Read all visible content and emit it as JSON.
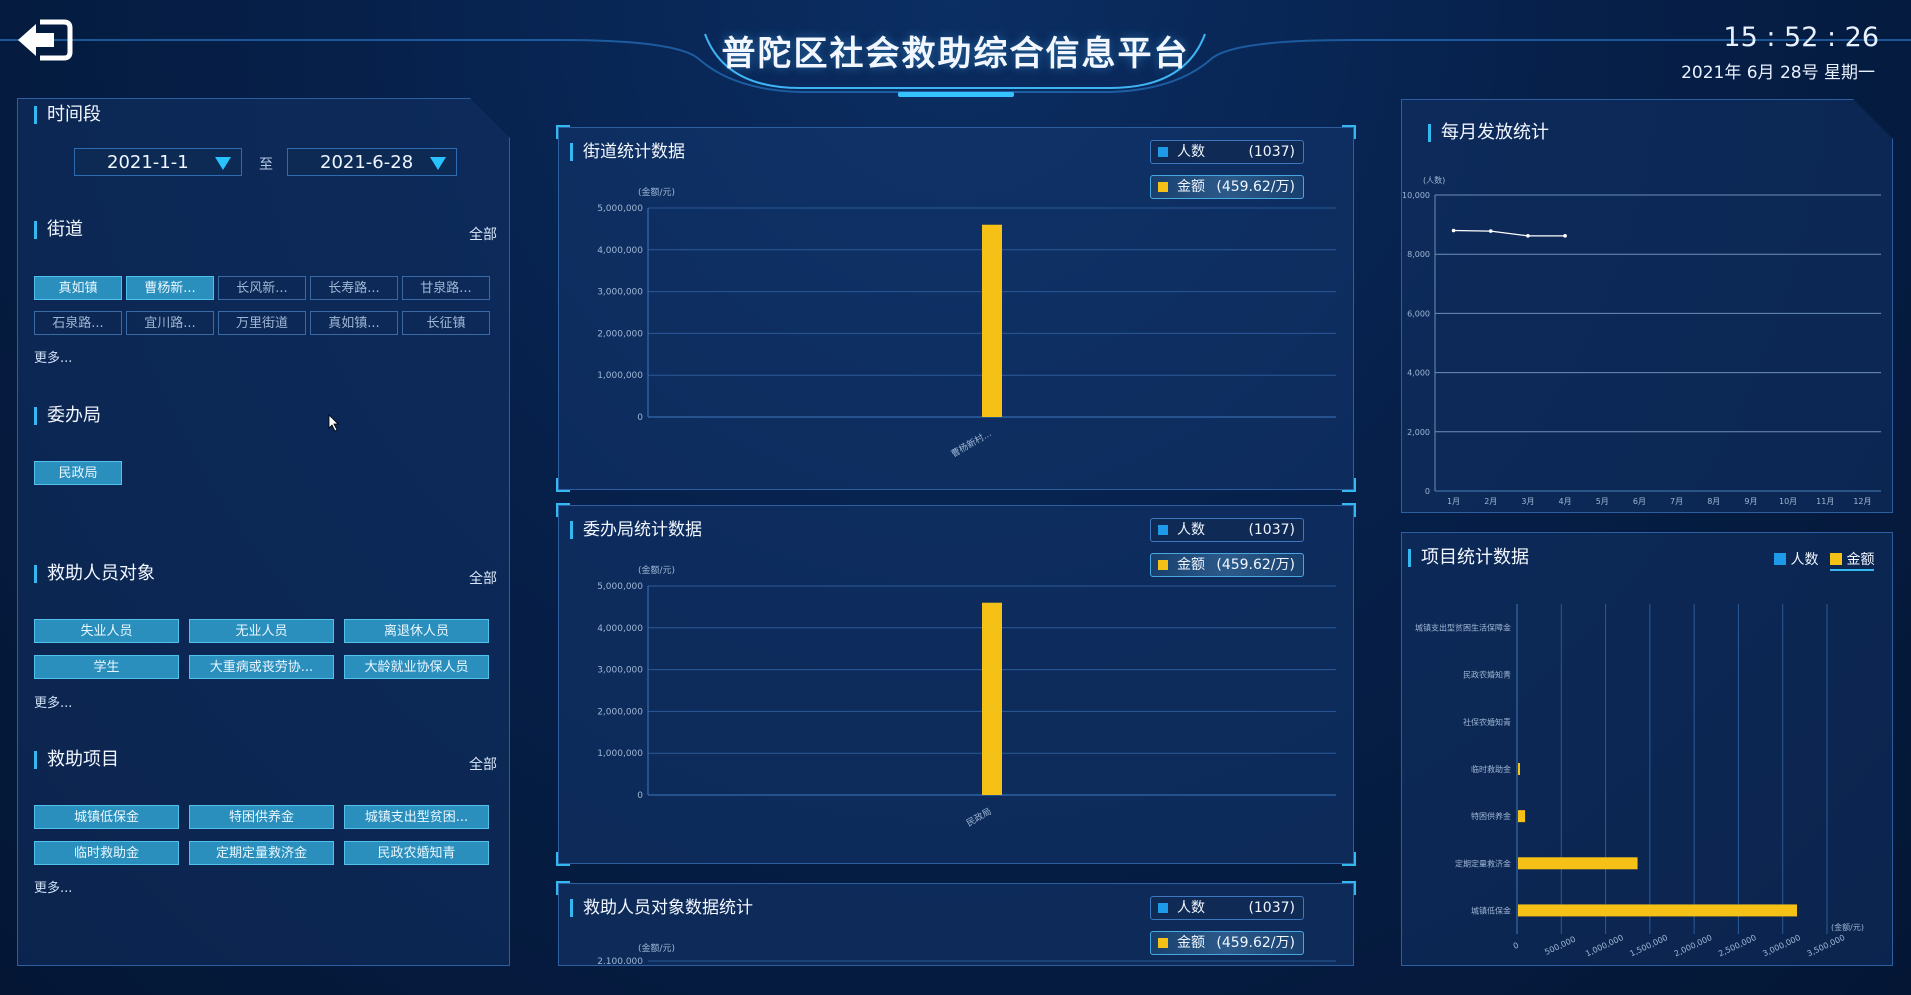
{
  "header": {
    "title": "普陀区社会救助综合信息平台",
    "clock": "15 : 52 : 26",
    "date": "2021年 6月 28号 星期一"
  },
  "filters": {
    "period": {
      "label": "时间段",
      "start": "2021-1-1",
      "separator": "至",
      "end": "2021-6-28"
    },
    "street": {
      "label": "街道",
      "all": "全部",
      "more": "更多...",
      "tags": [
        {
          "label": "真如镇",
          "active": true
        },
        {
          "label": "曹杨新...",
          "active": true
        },
        {
          "label": "长风新...",
          "active": false
        },
        {
          "label": "长寿路...",
          "active": false
        },
        {
          "label": "甘泉路...",
          "active": false
        },
        {
          "label": "石泉路...",
          "active": false
        },
        {
          "label": "宜川路...",
          "active": false
        },
        {
          "label": "万里街道",
          "active": false
        },
        {
          "label": "真如镇...",
          "active": false
        },
        {
          "label": "长征镇",
          "active": false
        }
      ]
    },
    "bureau": {
      "label": "委办局",
      "tags": [
        {
          "label": "民政局",
          "active": true
        }
      ]
    },
    "target": {
      "label": "救助人员对象",
      "all": "全部",
      "more": "更多...",
      "tags": [
        {
          "label": "失业人员",
          "active": true
        },
        {
          "label": "无业人员",
          "active": true
        },
        {
          "label": "离退休人员",
          "active": true
        },
        {
          "label": "学生",
          "active": true
        },
        {
          "label": "大重病或丧劳协...",
          "active": true
        },
        {
          "label": "大龄就业协保人员",
          "active": true
        }
      ]
    },
    "project": {
      "label": "救助项目",
      "all": "全部",
      "more": "更多...",
      "tags": [
        {
          "label": "城镇低保金",
          "active": true
        },
        {
          "label": "特困供养金",
          "active": true
        },
        {
          "label": "城镇支出型贫困...",
          "active": true
        },
        {
          "label": "临时救助金",
          "active": true
        },
        {
          "label": "定期定量救济金",
          "active": true
        },
        {
          "label": "民政农婚知青",
          "active": true
        }
      ]
    }
  },
  "legend": {
    "people_label": "人数",
    "people_value": "(1037)",
    "money_label": "金额",
    "money_value": "(459.62/万)",
    "people_color": "#1e9be8",
    "money_color": "#f5c116"
  },
  "colors": {
    "accent": "#33b8f0",
    "bar": "#f5c116",
    "line": "#ffffff"
  },
  "chart_data": [
    {
      "type": "bar",
      "title": "街道统计数据",
      "ylabel": "(金额/元)",
      "categories": [
        "曹杨新村..."
      ],
      "values": [
        4600000
      ],
      "ylim": [
        0,
        5000000
      ],
      "yticks": [
        "0",
        "1,000,000",
        "2,000,000",
        "3,000,000",
        "4,000,000",
        "5,000,000"
      ],
      "grid": true
    },
    {
      "type": "bar",
      "title": "委办局统计数据",
      "ylabel": "(金额/元)",
      "categories": [
        "民政局"
      ],
      "values": [
        4600000
      ],
      "ylim": [
        0,
        5000000
      ],
      "yticks": [
        "0",
        "1,000,000",
        "2,000,000",
        "3,000,000",
        "4,000,000",
        "5,000,000"
      ],
      "grid": true
    },
    {
      "type": "bar",
      "title": "救助人员对象数据统计",
      "ylabel": "(金额/元)",
      "yticks_visible": [
        "2,100,000"
      ]
    },
    {
      "type": "line",
      "title": "每月发放统计",
      "ylabel": "(人数)",
      "categories": [
        "1月",
        "2月",
        "3月",
        "4月",
        "5月",
        "6月",
        "7月",
        "8月",
        "9月",
        "10月",
        "11月",
        "12月"
      ],
      "values": [
        8800,
        8780,
        8620,
        8620
      ],
      "ylim": [
        0,
        10000
      ],
      "yticks": [
        "0",
        "2,000",
        "4,000",
        "6,000",
        "8,000",
        "10,000"
      ],
      "grid": true
    },
    {
      "type": "bar",
      "orientation": "horizontal",
      "title": "项目统计数据",
      "legend": [
        "人数",
        "金额"
      ],
      "xlabel": "(金额/元)",
      "categories": [
        "城镇支出型贫困生活保障金",
        "民政农婚知青",
        "社保农婚知青",
        "临时救助金",
        "特困供养金",
        "定期定量救济金",
        "城镇低保金"
      ],
      "values": [
        0,
        0,
        0,
        10000,
        80000,
        1350000,
        3150000
      ],
      "xlim": [
        0,
        3500000
      ],
      "xticks": [
        "0",
        "500,000",
        "1,000,000",
        "1,500,000",
        "2,000,000",
        "2,500,000",
        "3,000,000",
        "3,500,000"
      ],
      "grid": true
    }
  ]
}
